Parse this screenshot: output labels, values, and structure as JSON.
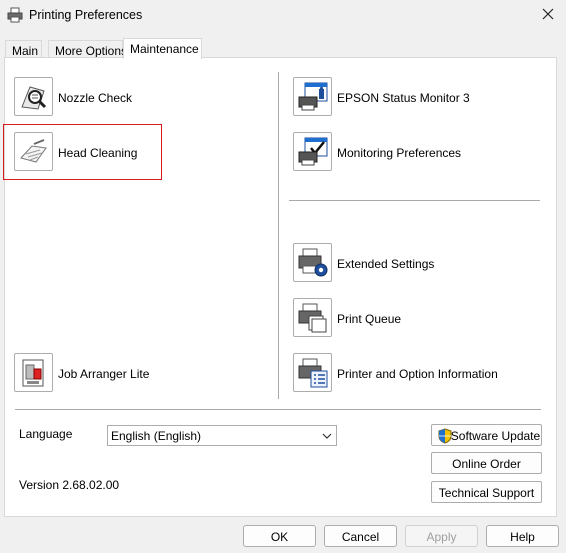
{
  "window": {
    "title": "Printing Preferences"
  },
  "tabs": [
    {
      "label": "Main"
    },
    {
      "label": "More Options"
    },
    {
      "label": "Maintenance"
    }
  ],
  "left_tools": {
    "nozzle_check": "Nozzle Check",
    "head_cleaning": "Head Cleaning",
    "job_arranger": "Job Arranger Lite"
  },
  "right_tools": {
    "status_monitor": "EPSON Status Monitor 3",
    "monitoring_prefs": "Monitoring Preferences",
    "extended_settings": "Extended Settings",
    "print_queue": "Print Queue",
    "printer_info": "Printer and Option Information"
  },
  "language": {
    "label": "Language",
    "selected": "English (English)"
  },
  "version": "Version 2.68.02.00",
  "side_buttons": {
    "software_update": "Software Update",
    "online_order": "Online Order",
    "technical_support": "Technical Support"
  },
  "footer": {
    "ok": "OK",
    "cancel": "Cancel",
    "apply": "Apply",
    "help": "Help"
  },
  "colors": {
    "highlight": "#d71a1a",
    "accent": "#1f6fd1"
  }
}
